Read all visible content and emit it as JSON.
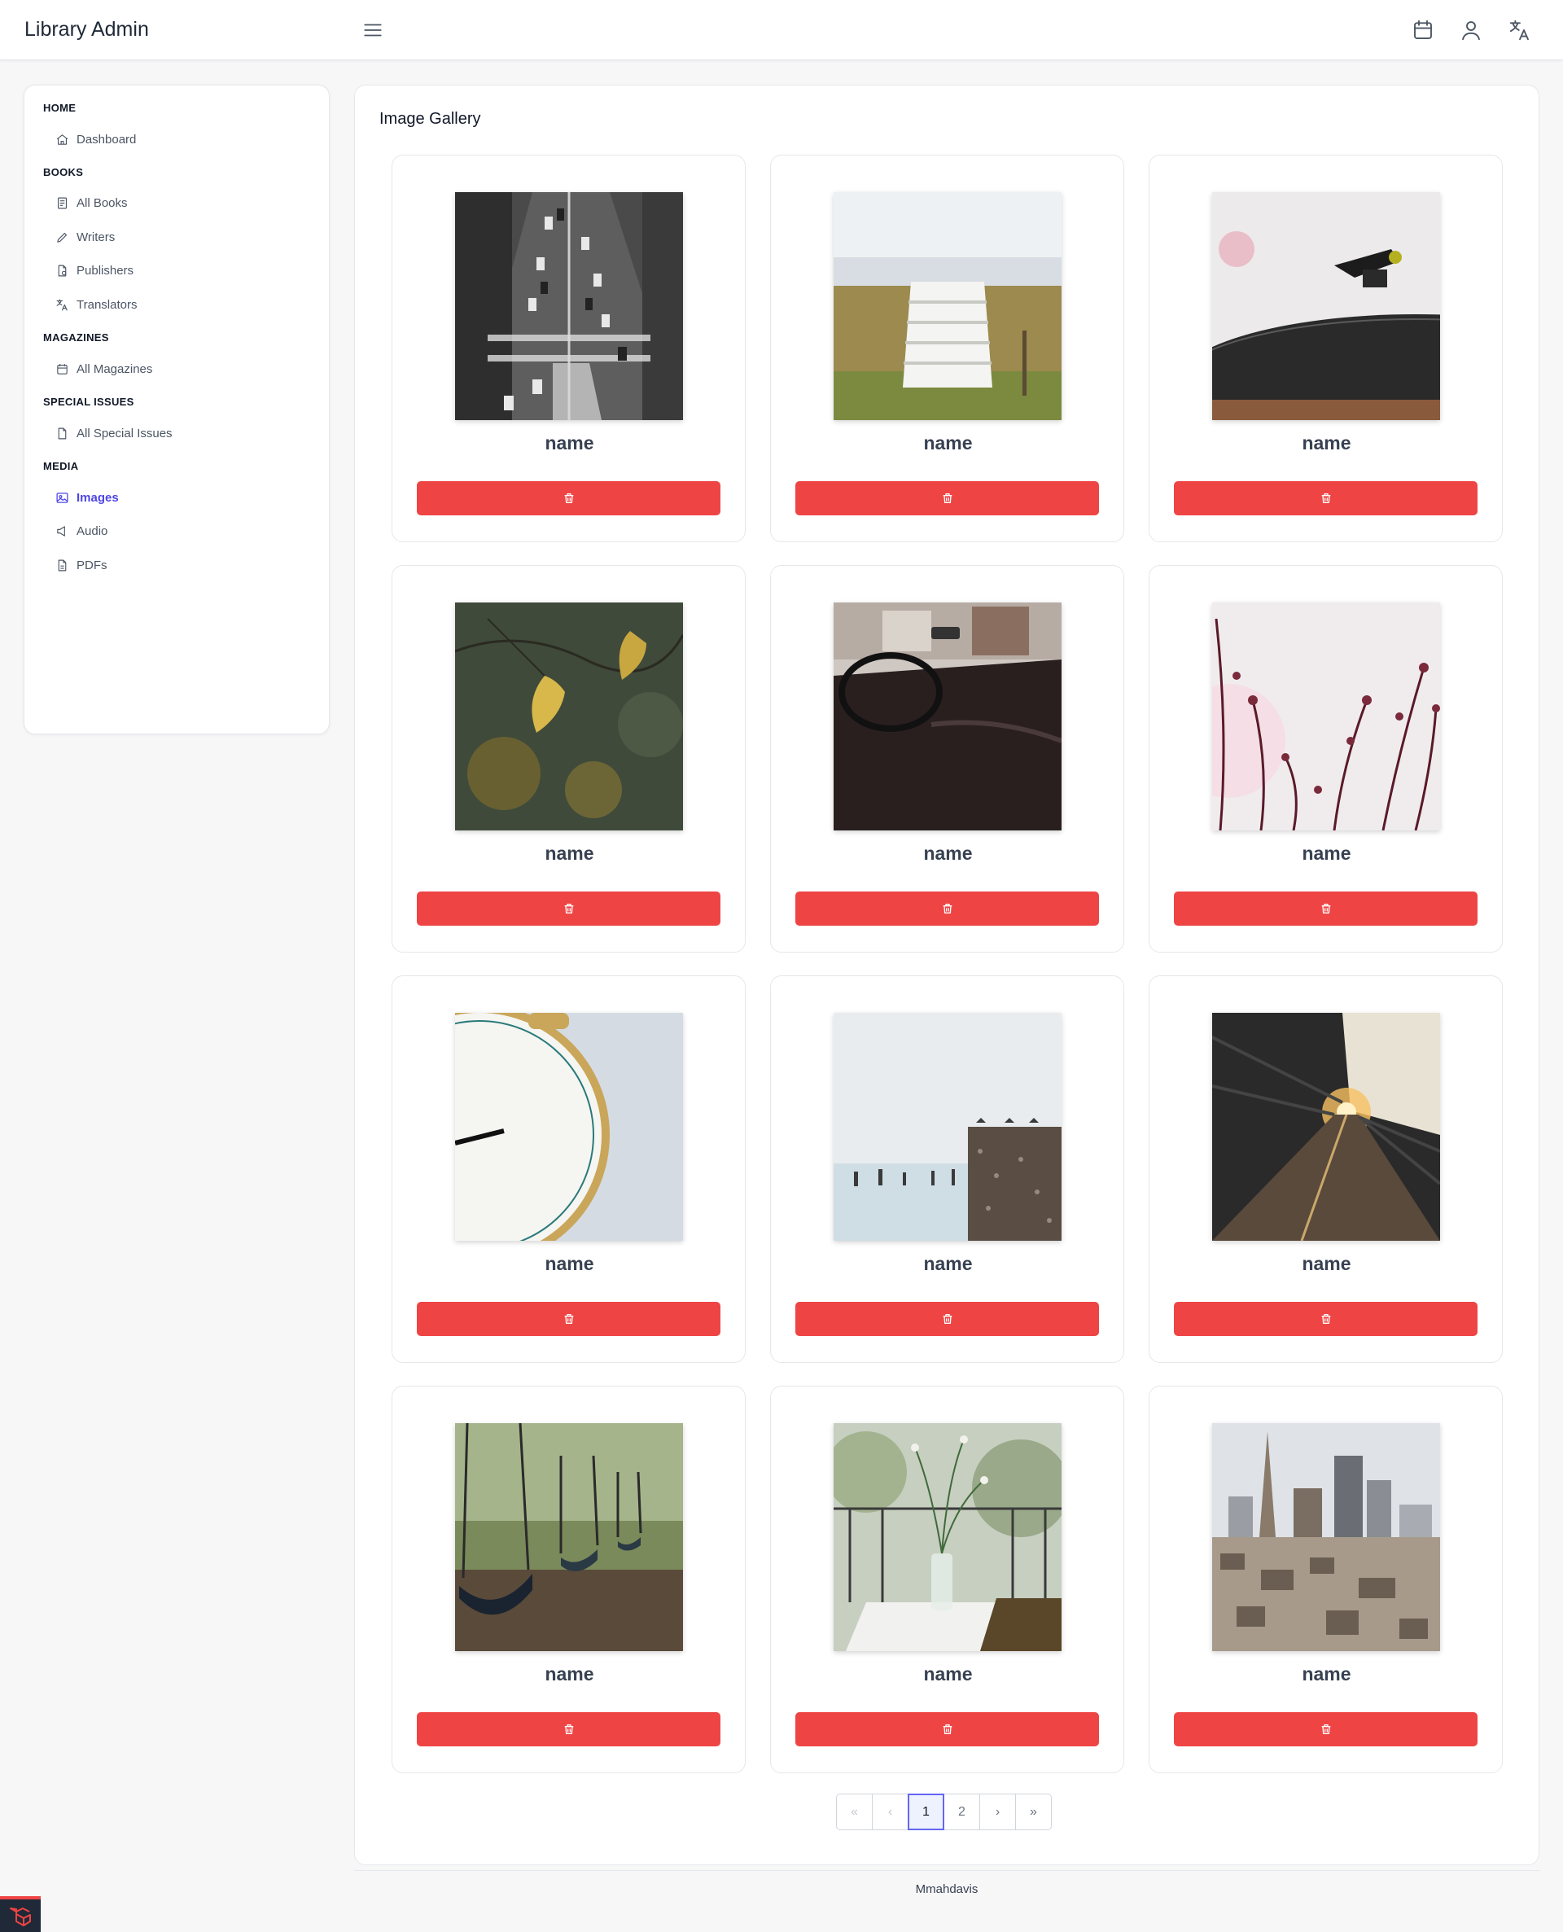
{
  "header": {
    "brand": "Library Admin",
    "icons": [
      "menu-icon",
      "calendar-icon",
      "user-icon",
      "translate-icon"
    ]
  },
  "sidebar": {
    "sections": [
      {
        "title": "HOME",
        "items": [
          {
            "label": "Dashboard",
            "icon": "home-icon"
          }
        ]
      },
      {
        "title": "BOOKS",
        "items": [
          {
            "label": "All Books",
            "icon": "book-icon"
          },
          {
            "label": "Writers",
            "icon": "pencil-icon"
          },
          {
            "label": "Publishers",
            "icon": "file-icon"
          },
          {
            "label": "Translators",
            "icon": "translate-icon"
          }
        ]
      },
      {
        "title": "MAGAZINES",
        "items": [
          {
            "label": "All Magazines",
            "icon": "calendar-icon"
          }
        ]
      },
      {
        "title": "SPECIAL ISSUES",
        "items": [
          {
            "label": "All Special Issues",
            "icon": "document-icon"
          }
        ]
      },
      {
        "title": "MEDIA",
        "items": [
          {
            "label": "Images",
            "icon": "image-icon",
            "active": true
          },
          {
            "label": "Audio",
            "icon": "speaker-icon"
          },
          {
            "label": "PDFs",
            "icon": "pdf-icon"
          }
        ]
      }
    ],
    "active_color": "#4f46e5"
  },
  "main": {
    "title": "Image Gallery",
    "delete_color": "#ef4444",
    "cards": [
      {
        "name": "name",
        "photo": "aerial-street-photo"
      },
      {
        "name": "name",
        "photo": "beach-steps-photo"
      },
      {
        "name": "name",
        "photo": "record-player-photo"
      },
      {
        "name": "name",
        "photo": "autumn-leaves-photo"
      },
      {
        "name": "name",
        "photo": "car-interior-photo"
      },
      {
        "name": "name",
        "photo": "blossom-branches-photo"
      },
      {
        "name": "name",
        "photo": "alarm-clock-photo"
      },
      {
        "name": "name",
        "photo": "sea-birds-photo"
      },
      {
        "name": "name",
        "photo": "train-platform-photo"
      },
      {
        "name": "name",
        "photo": "playground-swings-photo"
      },
      {
        "name": "name",
        "photo": "flower-vase-photo"
      },
      {
        "name": "name",
        "photo": "city-skyline-photo"
      }
    ]
  },
  "pagination": {
    "first": "«",
    "prev": "‹",
    "pages": [
      "1",
      "2"
    ],
    "current": "1",
    "next": "›",
    "last": "»"
  },
  "footer": {
    "text": "Mmahdavis"
  }
}
